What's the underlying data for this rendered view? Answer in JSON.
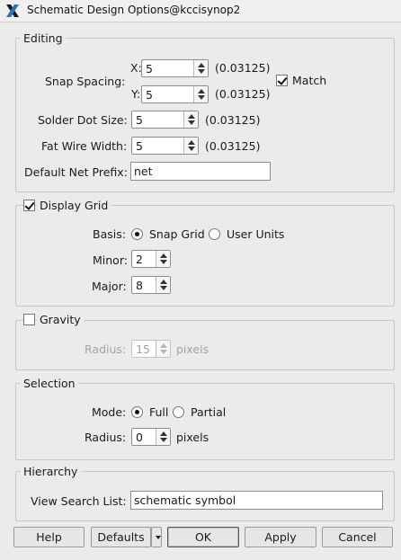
{
  "window": {
    "title": "Schematic Design Options@kccisynop2"
  },
  "editing": {
    "title": "Editing",
    "snap_spacing_label": "Snap Spacing:",
    "x_label": "X:",
    "x_value": "5",
    "x_units": "(0.03125)",
    "y_label": "Y:",
    "y_value": "5",
    "y_units": "(0.03125)",
    "match_label": "Match",
    "match_checked": true,
    "solder_label": "Solder Dot Size:",
    "solder_value": "5",
    "solder_units": "(0.03125)",
    "fatwire_label": "Fat Wire Width:",
    "fatwire_value": "5",
    "fatwire_units": "(0.03125)",
    "prefix_label": "Default Net Prefix:",
    "prefix_value": "net"
  },
  "grid": {
    "title": "Display Grid",
    "checked": true,
    "basis_label": "Basis:",
    "basis_options": [
      "Snap Grid",
      "User Units"
    ],
    "basis_selected": "Snap Grid",
    "minor_label": "Minor:",
    "minor_value": "2",
    "major_label": "Major:",
    "major_value": "8"
  },
  "gravity": {
    "title": "Gravity",
    "checked": false,
    "radius_label": "Radius:",
    "radius_value": "15",
    "radius_units": "pixels"
  },
  "selection": {
    "title": "Selection",
    "mode_label": "Mode:",
    "mode_options": [
      "Full",
      "Partial"
    ],
    "mode_selected": "Full",
    "radius_label": "Radius:",
    "radius_value": "0",
    "radius_units": "pixels"
  },
  "hierarchy": {
    "title": "Hierarchy",
    "search_label": "View Search List:",
    "search_value": "schematic symbol"
  },
  "buttons": {
    "help": "Help",
    "defaults": "Defaults",
    "ok": "OK",
    "apply": "Apply",
    "cancel": "Cancel"
  }
}
